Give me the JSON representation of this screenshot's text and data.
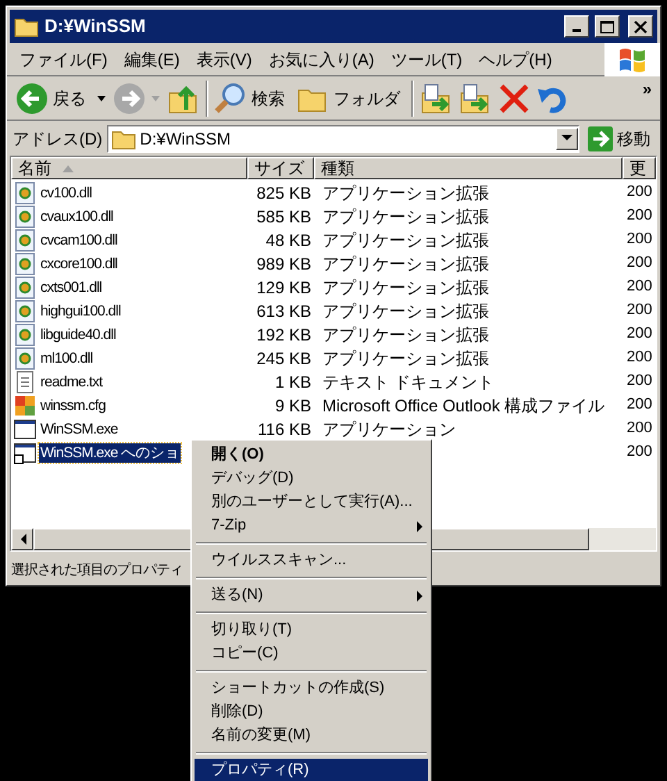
{
  "window": {
    "title": "D:¥WinSSM"
  },
  "menu_bar": [
    "ファイル(F)",
    "編集(E)",
    "表示(V)",
    "お気に入り(A)",
    "ツール(T)",
    "ヘルプ(H)"
  ],
  "toolbar": [
    {
      "kind": "back",
      "label": "戻る",
      "disabled": false
    },
    {
      "kind": "forward",
      "disabled": true
    },
    {
      "kind": "up"
    },
    {
      "kind": "search",
      "label": "検索"
    },
    {
      "kind": "folders",
      "label": "フォルダ"
    },
    {
      "kind": "move"
    },
    {
      "kind": "copy"
    },
    {
      "kind": "delete"
    },
    {
      "kind": "undo"
    }
  ],
  "toolbar_more": "»",
  "address": {
    "label": "アドレス(D)",
    "value": "D:¥WinSSM",
    "go": "移動"
  },
  "table": {
    "columns": [
      "名前",
      "サイズ",
      "種類",
      "更"
    ],
    "rows": [
      {
        "kind": "dll",
        "name": "cv100.dll",
        "size": "825 KB",
        "type": "アプリケーション拡張",
        "date": "200",
        "selected": false
      },
      {
        "kind": "dll",
        "name": "cvaux100.dll",
        "size": "585 KB",
        "type": "アプリケーション拡張",
        "date": "200",
        "selected": false
      },
      {
        "kind": "dll",
        "name": "cvcam100.dll",
        "size": "48 KB",
        "type": "アプリケーション拡張",
        "date": "200",
        "selected": false
      },
      {
        "kind": "dll",
        "name": "cxcore100.dll",
        "size": "989 KB",
        "type": "アプリケーション拡張",
        "date": "200",
        "selected": false
      },
      {
        "kind": "dll",
        "name": "cxts001.dll",
        "size": "129 KB",
        "type": "アプリケーション拡張",
        "date": "200",
        "selected": false
      },
      {
        "kind": "dll",
        "name": "highgui100.dll",
        "size": "613 KB",
        "type": "アプリケーション拡張",
        "date": "200",
        "selected": false
      },
      {
        "kind": "dll",
        "name": "libguide40.dll",
        "size": "192 KB",
        "type": "アプリケーション拡張",
        "date": "200",
        "selected": false
      },
      {
        "kind": "dll",
        "name": "ml100.dll",
        "size": "245 KB",
        "type": "アプリケーション拡張",
        "date": "200",
        "selected": false
      },
      {
        "kind": "txt",
        "name": "readme.txt",
        "size": "1 KB",
        "type": "テキスト ドキュメント",
        "date": "200",
        "selected": false
      },
      {
        "kind": "cfg",
        "name": "winssm.cfg",
        "size": "9 KB",
        "type": "Microsoft Office Outlook 構成ファイル",
        "date": "200",
        "selected": false
      },
      {
        "kind": "exe",
        "name": "WinSSM.exe",
        "size": "116 KB",
        "type": "アプリケーション",
        "date": "200",
        "selected": false
      },
      {
        "kind": "shortcut",
        "name": "WinSSM.exe へのショ",
        "date": "200",
        "selected": true
      }
    ]
  },
  "status_bar": "選択された項目のプロパティ",
  "context_menu": [
    {
      "kind": "item",
      "label": "開く(O)",
      "default": true,
      "submenu": false,
      "selected": false
    },
    {
      "kind": "item",
      "label": "デバッグ(D)",
      "default": false,
      "submenu": false,
      "selected": false
    },
    {
      "kind": "item",
      "label": "別のユーザーとして実行(A)...",
      "default": false,
      "submenu": false,
      "selected": false
    },
    {
      "kind": "item",
      "label": "7-Zip",
      "default": false,
      "submenu": true,
      "selected": false
    },
    {
      "kind": "separator"
    },
    {
      "kind": "item",
      "label": "ウイルススキャン...",
      "default": false,
      "submenu": false,
      "selected": false
    },
    {
      "kind": "separator"
    },
    {
      "kind": "item",
      "label": "送る(N)",
      "default": false,
      "submenu": true,
      "selected": false
    },
    {
      "kind": "separator"
    },
    {
      "kind": "item",
      "label": "切り取り(T)",
      "default": false,
      "submenu": false,
      "selected": false
    },
    {
      "kind": "item",
      "label": "コピー(C)",
      "default": false,
      "submenu": false,
      "selected": false
    },
    {
      "kind": "separator"
    },
    {
      "kind": "item",
      "label": "ショートカットの作成(S)",
      "default": false,
      "submenu": false,
      "selected": false
    },
    {
      "kind": "item",
      "label": "削除(D)",
      "default": false,
      "submenu": false,
      "selected": false
    },
    {
      "kind": "item",
      "label": "名前の変更(M)",
      "default": false,
      "submenu": false,
      "selected": false
    },
    {
      "kind": "separator"
    },
    {
      "kind": "item",
      "label": "プロパティ(R)",
      "default": false,
      "submenu": false,
      "selected": true
    }
  ]
}
